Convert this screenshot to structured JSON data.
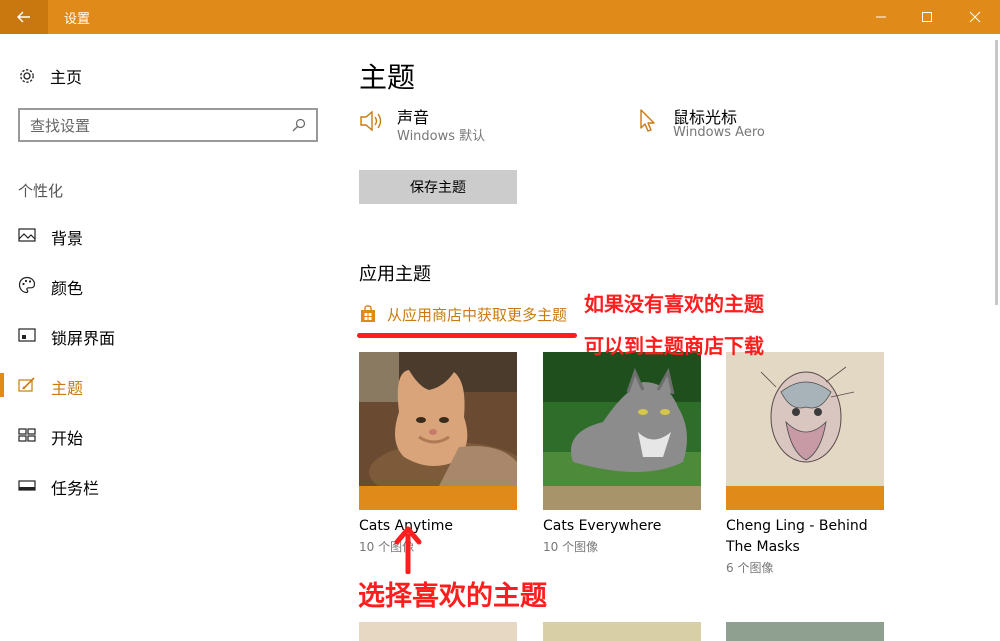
{
  "window": {
    "title": "设置",
    "accent": "#e08a1a"
  },
  "sidebar": {
    "home_label": "主页",
    "search_placeholder": "查找设置",
    "section_label": "个性化",
    "items": [
      {
        "label": "背景",
        "icon": "picture-icon"
      },
      {
        "label": "颜色",
        "icon": "palette-icon"
      },
      {
        "label": "锁屏界面",
        "icon": "lock-screen-icon"
      },
      {
        "label": "主题",
        "icon": "theme-brush-icon",
        "active": true
      },
      {
        "label": "开始",
        "icon": "start-grid-icon"
      },
      {
        "label": "任务栏",
        "icon": "taskbar-icon"
      }
    ]
  },
  "main": {
    "title": "主题",
    "sound": {
      "name": "声音",
      "value": "Windows 默认"
    },
    "cursor": {
      "name": "鼠标光标",
      "value": "Windows Aero"
    },
    "save_button": "保存主题",
    "apply_title": "应用主题",
    "store_link": "从应用商店中获取更多主题",
    "themes": [
      {
        "name": "Cats Anytime",
        "count": "10 个图像",
        "band": "#e08a1a"
      },
      {
        "name": "Cats Everywhere",
        "count": "10 个图像",
        "band": "#a8946a"
      },
      {
        "name_line1": "Cheng Ling - Behind",
        "name_line2": "The Masks",
        "count": "6 个图像",
        "band": "#e08a1a"
      }
    ]
  },
  "annotations": {
    "line1": "如果没有喜欢的主题",
    "line2": "可以到主题商店下载",
    "line3": "选择喜欢的主题",
    "color": "#ff1d1d"
  }
}
